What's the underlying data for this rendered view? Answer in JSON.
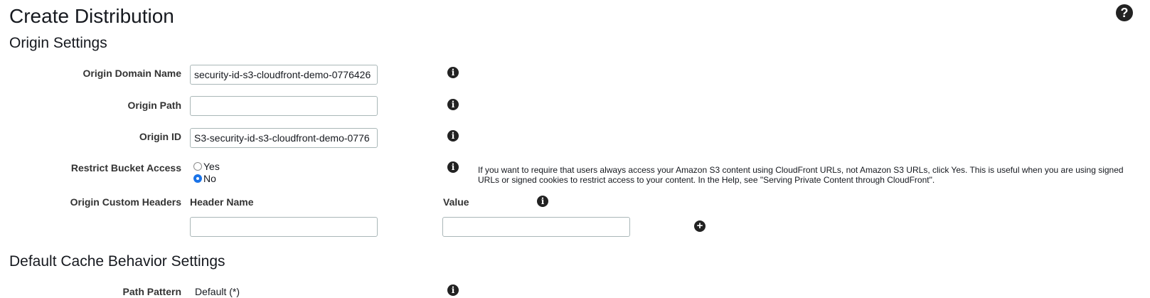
{
  "header": {
    "title": "Create Distribution",
    "help_icon": "question-circle-icon",
    "help_glyph": "?"
  },
  "origin_settings": {
    "title": "Origin Settings",
    "domain_name": {
      "label": "Origin Domain Name",
      "value": "security-id-s3-cloudfront-demo-0776426"
    },
    "path": {
      "label": "Origin Path",
      "value": ""
    },
    "origin_id": {
      "label": "Origin ID",
      "value": "S3-security-id-s3-cloudfront-demo-0776"
    },
    "restrict_access": {
      "label": "Restrict Bucket Access",
      "options": [
        "Yes",
        "No"
      ],
      "selected": "No",
      "help": "If you want to require that users always access your Amazon S3 content using CloudFront URLs, not Amazon S3 URLs, click Yes. This is useful when you are using signed URLs or signed cookies to restrict access to your content. In the Help, see \"Serving Private Content through CloudFront\"."
    },
    "custom_headers": {
      "label": "Origin Custom Headers",
      "header_name_label": "Header Name",
      "value_label": "Value",
      "header_name_value": "",
      "value_value": "",
      "add_icon": "plus-circle-icon",
      "add_glyph": "+"
    },
    "info_icon": "info-circle-icon",
    "info_glyph": "i"
  },
  "cache_behavior": {
    "title": "Default Cache Behavior Settings",
    "path_pattern": {
      "label": "Path Pattern",
      "value": "Default (*)"
    }
  }
}
